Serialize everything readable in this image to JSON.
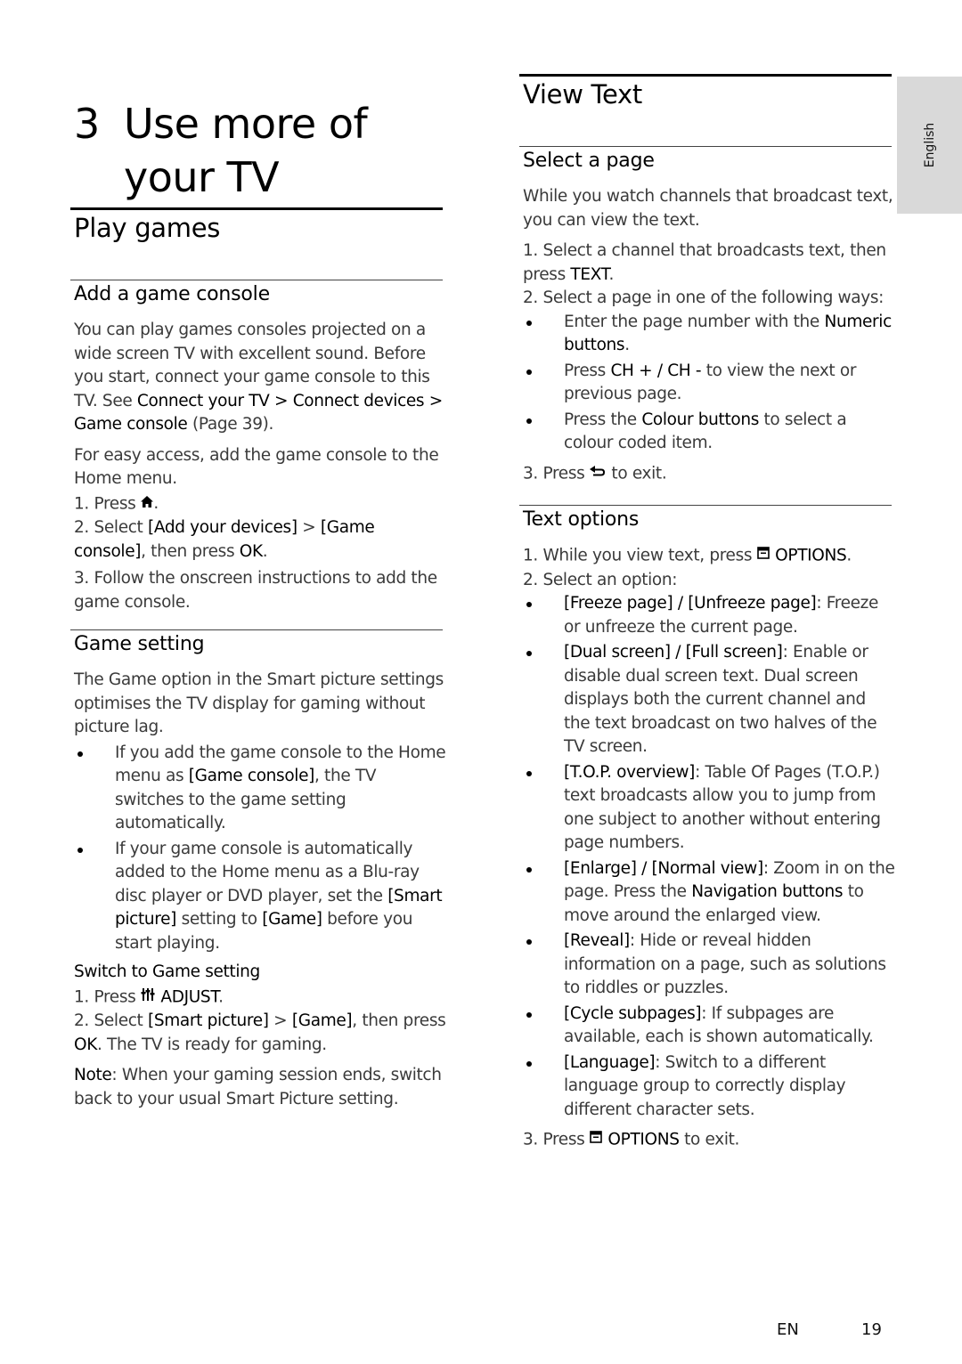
{
  "chapter": {
    "number": "3",
    "title_line1": "Use more of",
    "title_line2": "your TV"
  },
  "language_tab": "English",
  "footer": {
    "language": "EN",
    "page_number": "19"
  },
  "left": {
    "section_title": "Play games",
    "add_console": {
      "heading": "Add a game console",
      "intro_1": "You can play games consoles projected on a wide screen TV with excellent sound. Before you start, connect your game console to this TV. See ",
      "intro_link": "Connect your TV > Connect devices > Game console",
      "intro_2": " (Page 39).",
      "easy_access": "For easy access, add the game console to the Home menu.",
      "step1_prefix": "1. Press",
      "step1_icon": "home-icon",
      "step1_suffix": ".",
      "step2_prefix": "2. Select ",
      "step2_b1": "[Add your devices]",
      "step2_sep": " > ",
      "step2_b2": "[Game console]",
      "step2_mid": ", then press ",
      "step2_b3": "OK",
      "step2_end": ".",
      "step3": "3. Follow the onscreen instructions to add the game console."
    },
    "game_setting": {
      "heading": "Game setting",
      "intro": "The Game option in the Smart picture settings optimises the TV display for gaming without picture lag.",
      "bullet1_a": "If you add the game console to the Home menu as ",
      "bullet1_b": "[Game console]",
      "bullet1_c": ", the TV switches to the game setting automatically.",
      "bullet2_a": "If your game console is automatically added to the Home menu as a Blu-ray disc player or DVD player, set the ",
      "bullet2_b": "[Smart picture]",
      "bullet2_c": " setting to ",
      "bullet2_d": "[Game]",
      "bullet2_e": " before you start playing.",
      "switch_heading": "Switch to Game setting",
      "s1_prefix": "1. Press",
      "s1_icon": "adjust-icon",
      "s1_key": "ADJUST",
      "s1_end": ".",
      "s2_prefix": "2. Select ",
      "s2_b1": "[Smart picture]",
      "s2_sep": " > ",
      "s2_b2": "[Game]",
      "s2_mid": ", then press ",
      "s2_b3": "OK",
      "s2_end": ". The TV is ready for gaming.",
      "note_label": "Note",
      "note_text": ": When your gaming session ends, switch back to your usual Smart Picture setting."
    }
  },
  "right": {
    "section_title": "View Text",
    "select_page": {
      "heading": "Select a page",
      "intro": "While you watch channels that broadcast text, you can view the text.",
      "step1_a": "1. Select a channel that broadcasts text, then press ",
      "step1_b": "TEXT",
      "step1_c": ".",
      "step2": "2. Select a page in one of the following ways:",
      "bullet1_a": "Enter the page number with the ",
      "bullet1_b": "Numeric buttons",
      "bullet1_c": ".",
      "bullet2_a": "Press ",
      "bullet2_b": "CH + / CH -",
      "bullet2_c": " to view the next or previous page.",
      "bullet3_a": "Press the ",
      "bullet3_b": "Colour buttons",
      "bullet3_c": " to select a colour coded item.",
      "step3_prefix": "3. Press",
      "step3_icon": "back-icon",
      "step3_suffix": "to exit."
    },
    "text_options": {
      "heading": "Text options",
      "step1_prefix": "1. While you view text, press",
      "step1_icon": "options-icon",
      "step1_key": "OPTIONS",
      "step1_end": ".",
      "step2": "2. Select an option:",
      "options": [
        {
          "label": "[Freeze page] / [Unfreeze page]",
          "desc": ": Freeze or unfreeze the current page."
        },
        {
          "label": "[Dual screen] / [Full screen]",
          "desc": ": Enable or disable dual screen text. Dual screen displays both the current channel and the text broadcast on two halves of the TV screen."
        },
        {
          "label": "[T.O.P. overview]",
          "desc": ": Table Of Pages (T.O.P.) text broadcasts allow you to jump from one subject to another without entering page numbers."
        },
        {
          "label": "[Enlarge] / [Normal view]",
          "desc": ": Zoom in on the page. Press the ",
          "desc_b": "Navigation buttons",
          "desc_c": " to move around the enlarged view."
        },
        {
          "label": "[Reveal]",
          "desc": ": Hide or reveal hidden information on a page, such as solutions to riddles or puzzles."
        },
        {
          "label": "[Cycle subpages]",
          "desc": ": If subpages are available, each is shown automatically."
        },
        {
          "label": "[Language]",
          "desc": ": Switch to a different language group to correctly display different character sets."
        }
      ],
      "step3_prefix": "3. Press",
      "step3_icon": "options-icon",
      "step3_key": "OPTIONS",
      "step3_suffix": " to exit."
    }
  }
}
